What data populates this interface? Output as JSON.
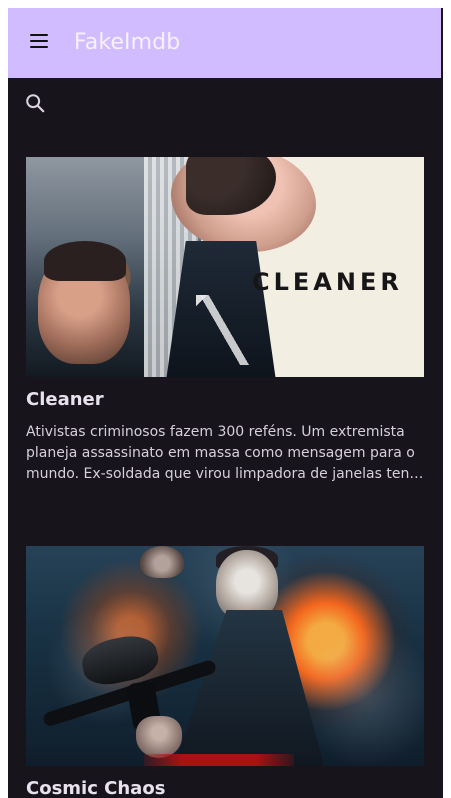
{
  "app": {
    "title": "FakeImdb"
  },
  "icons": {
    "menu": "menu-icon",
    "search": "search-icon"
  },
  "movies": [
    {
      "title": "Cleaner",
      "description": "Ativistas criminosos fazem 300 reféns. Um extremista planeja assassinato em massa como mensagem para o mundo. Ex-soldada que virou limpadora de janelas tenta impedi-lo.",
      "poster_text": "CLEANER"
    },
    {
      "title": "Cosmic Chaos",
      "description": ""
    }
  ]
}
